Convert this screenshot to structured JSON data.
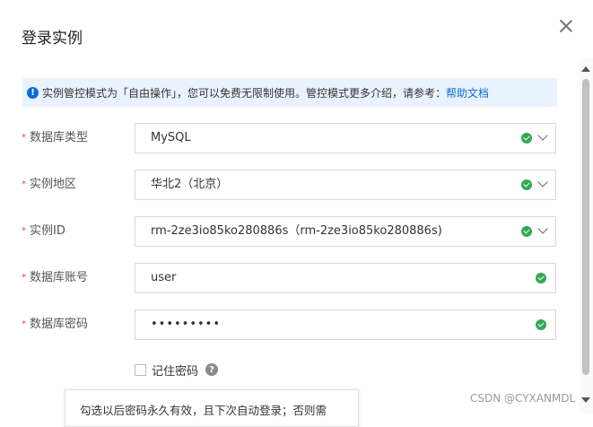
{
  "dialog": {
    "title": "登录实例",
    "close_label": "×"
  },
  "notice": {
    "text": "实例管控模式为「自由操作」，您可以免费无限制使用。管控模式更多介绍，请参考：",
    "link": "帮助文档",
    "icon": "info-icon"
  },
  "form": {
    "fields": [
      {
        "label": "数据库类型",
        "value": "MySQL",
        "valid": true,
        "dropdown": true
      },
      {
        "label": "实例地区",
        "value": "华北2（北京）",
        "valid": true,
        "dropdown": true
      },
      {
        "label": "实例ID",
        "value": "rm-2ze3io85ko280886s（rm-2ze3io85ko280886s)",
        "valid": true,
        "dropdown": true
      },
      {
        "label": "数据库账号",
        "value": "user",
        "valid": true,
        "dropdown": false
      },
      {
        "label": "数据库密码",
        "value": "•••••••••",
        "valid": true,
        "dropdown": false
      }
    ],
    "required_mark": "*",
    "remember_label": "记住密码",
    "remember_checked": false
  },
  "tooltip": {
    "text": "勾选以后密码永久有效，且下次自动登录；否则需"
  },
  "watermark": "CSDN @CYXANMDL",
  "colors": {
    "accent": "#0a6dd9",
    "notice_bg": "#e9f3fd",
    "success": "#34a853",
    "required": "#e34a4a"
  }
}
